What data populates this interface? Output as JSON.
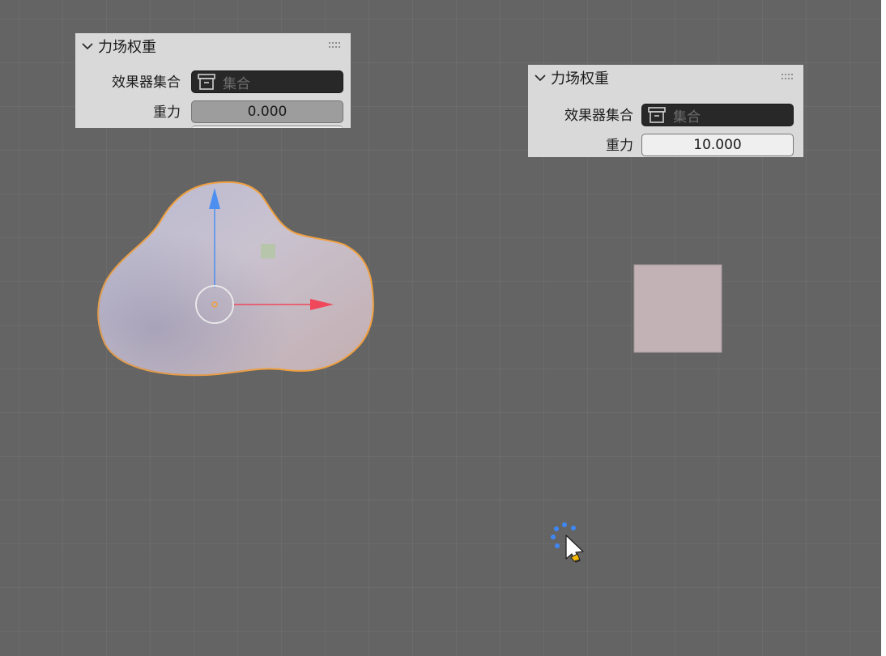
{
  "panels": [
    {
      "title": "力场权重",
      "effector_label": "效果器集合",
      "effector_placeholder": "集合",
      "gravity_label": "重力",
      "gravity_value": "0.000"
    },
    {
      "title": "力场权重",
      "effector_label": "效果器集合",
      "effector_placeholder": "集合",
      "gravity_label": "重力",
      "gravity_value": "10.000"
    }
  ],
  "colors": {
    "viewport_bg": "#646464",
    "selection_outline": "#f0a040",
    "axis_z": "#4d8ff0",
    "axis_x": "#f0475a",
    "cursor_spinner": "#3d87f5"
  },
  "icons": {
    "collapse": "chevron-down-icon",
    "drag": "grip-dots-icon",
    "collection": "collection-box-icon",
    "cursor": "mouse-pointer-icon",
    "loading": "loading-spinner-icon"
  }
}
